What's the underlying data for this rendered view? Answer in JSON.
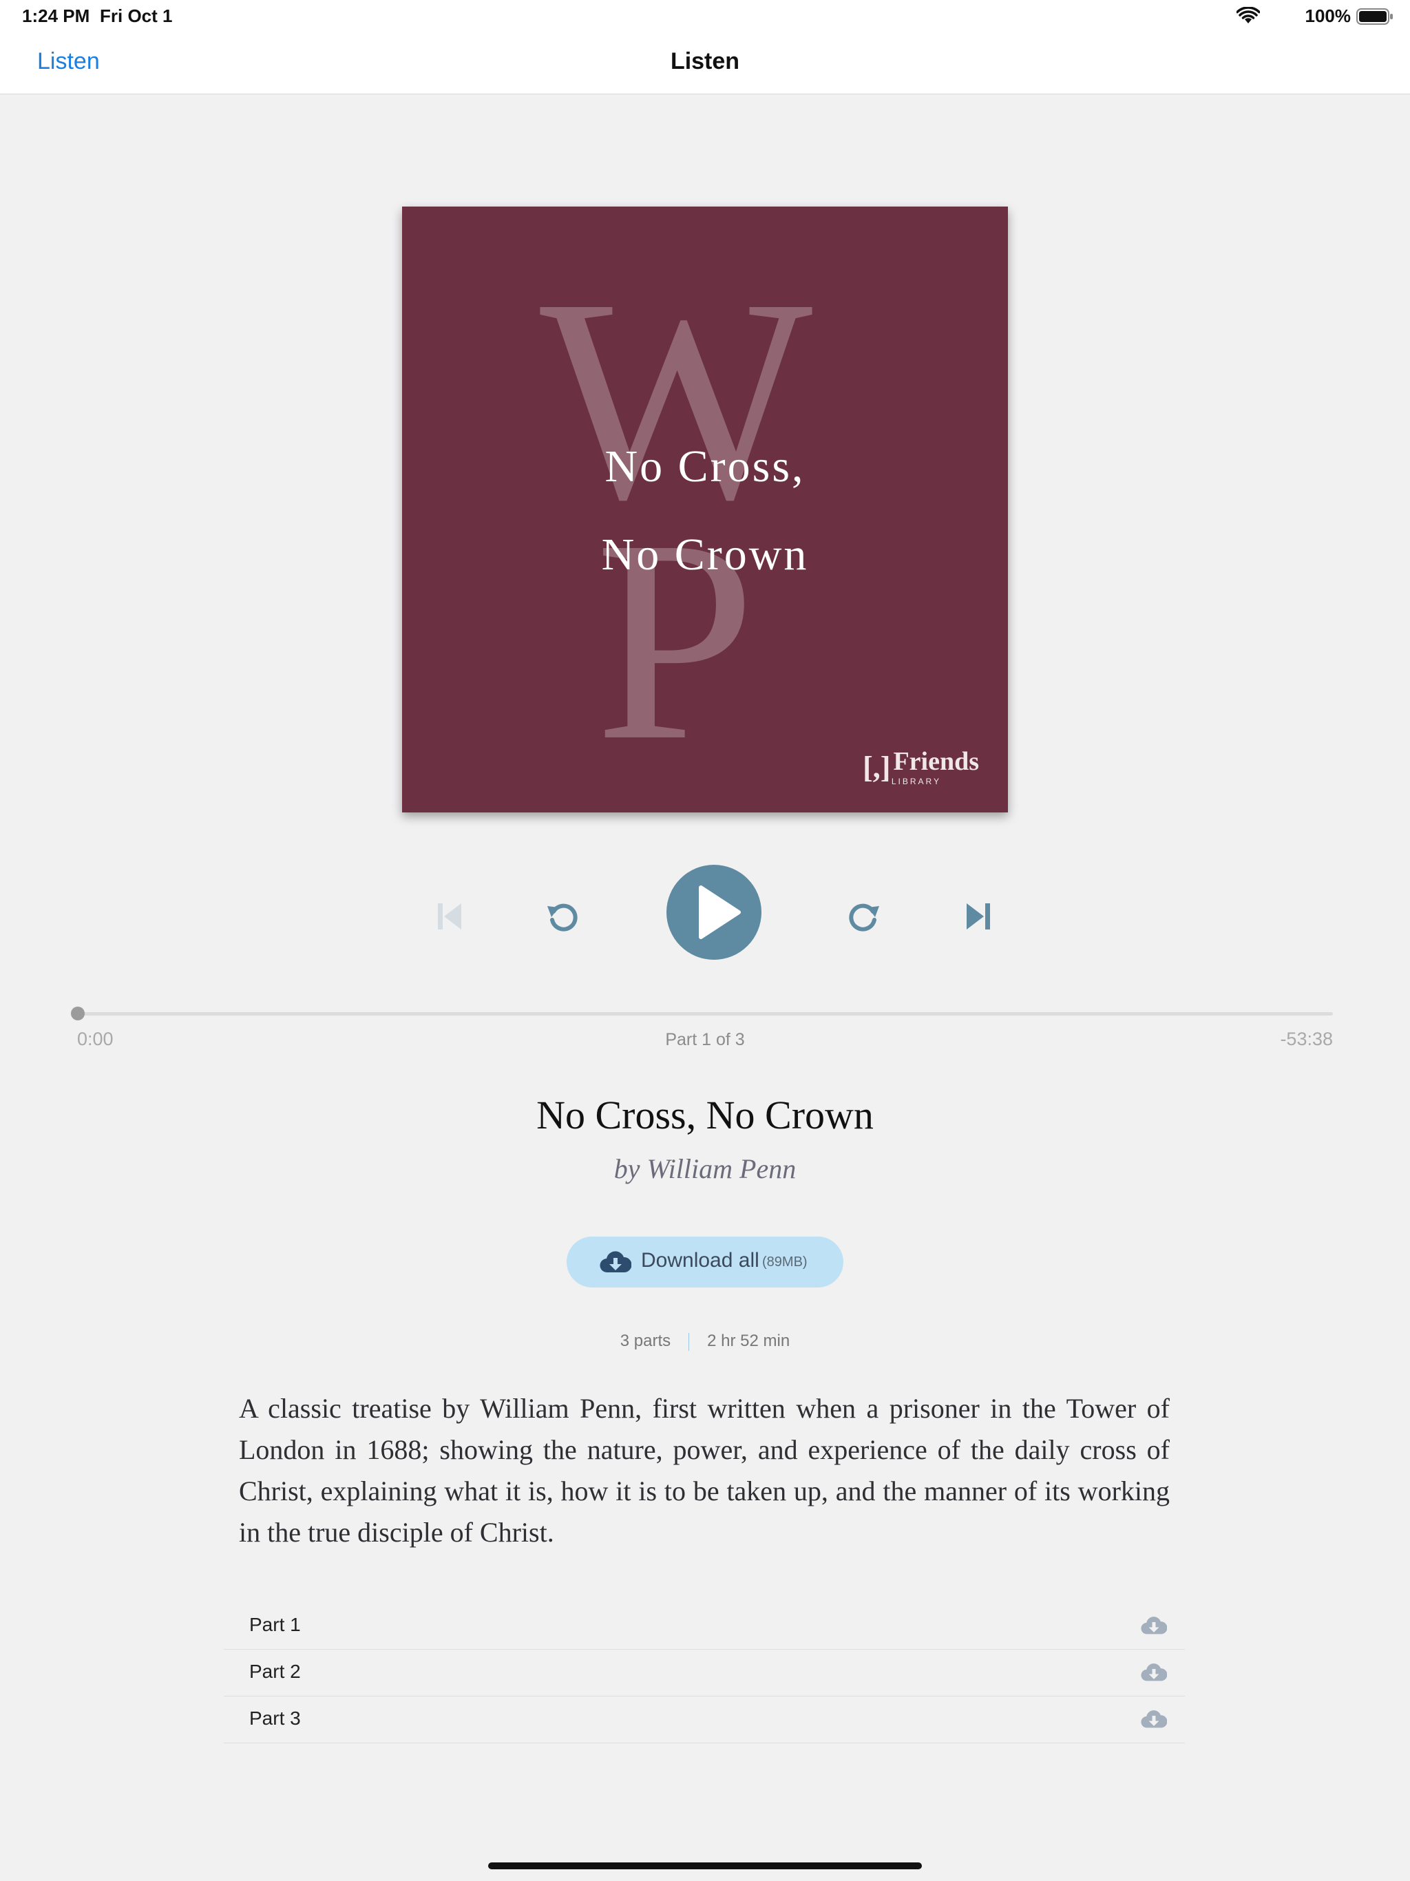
{
  "status_bar": {
    "time": "1:24 PM",
    "date": "Fri Oct 1",
    "battery": "100%",
    "icons": [
      "wifi-icon",
      "battery-icon"
    ]
  },
  "nav": {
    "back_label": "Listen",
    "title": "Listen"
  },
  "cover": {
    "monogram_top": "W",
    "monogram_bottom": "P",
    "title_line1": "No Cross,",
    "title_line2": "No Crown",
    "logo_mark": "[,]",
    "logo_name": "Friends",
    "logo_sub": "LIBRARY",
    "background_color": "#6b3042"
  },
  "player": {
    "controls": [
      "skip-previous-icon",
      "rewind-icon",
      "play-icon",
      "fast-forward-icon",
      "skip-next-icon"
    ],
    "elapsed": "0:00",
    "part_label": "Part 1 of 3",
    "remaining": "-53:38",
    "progress": 0,
    "accent_color": "#5e8aa2"
  },
  "book": {
    "title": "No Cross, No Crown",
    "author": "by William Penn",
    "download_all_label": "Download all",
    "download_all_size": "(89MB)",
    "parts_count": "3 parts",
    "duration": "2 hr 52 min",
    "description": "A classic treatise by William Penn, first written when a prisoner in the Tower of London in 1688; showing the nature, power, and experience of the daily cross of Christ, explaining what it is, how it is to be taken up, and the manner of its working in the true disciple of Christ."
  },
  "parts": [
    {
      "label": "Part 1"
    },
    {
      "label": "Part 2"
    },
    {
      "label": "Part 3"
    }
  ]
}
